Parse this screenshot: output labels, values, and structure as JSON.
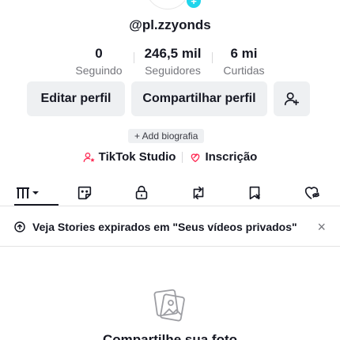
{
  "profile": {
    "username": "@pl.zzyonds",
    "add_avatar_glyph": "+"
  },
  "stats": [
    {
      "value": "0",
      "label": "Seguindo"
    },
    {
      "value": "246,5 mil",
      "label": "Seguidores"
    },
    {
      "value": "6 mi",
      "label": "Curtidas"
    }
  ],
  "actions": {
    "edit_label": "Editar perfil",
    "share_label": "Compartilhar perfil",
    "add_friend_icon": "person-plus-icon"
  },
  "bio": {
    "add_label": "+ Add biografia"
  },
  "links": {
    "studio_label": "TikTok Studio",
    "studio_icon": "person-star-icon",
    "subscription_label": "Inscrição",
    "subscription_icon": "heart-link-icon",
    "accent_color": "#fe2c55"
  },
  "tabs": [
    {
      "name": "videos",
      "icon": "grid-bars-icon",
      "active": true
    },
    {
      "name": "stickers",
      "icon": "sticker-icon",
      "active": false
    },
    {
      "name": "private",
      "icon": "lock-icon",
      "active": false
    },
    {
      "name": "reposts",
      "icon": "repost-icon",
      "active": false
    },
    {
      "name": "favorites",
      "icon": "bookmark-icon",
      "active": false
    },
    {
      "name": "liked",
      "icon": "hidden-heart-icon",
      "active": false
    }
  ],
  "banner": {
    "text": "Veja Stories expirados em \"Seus vídeos privados\"",
    "close_glyph": "×"
  },
  "empty_state": {
    "icon": "photos-icon",
    "title": "Compartilhe sua foto"
  }
}
